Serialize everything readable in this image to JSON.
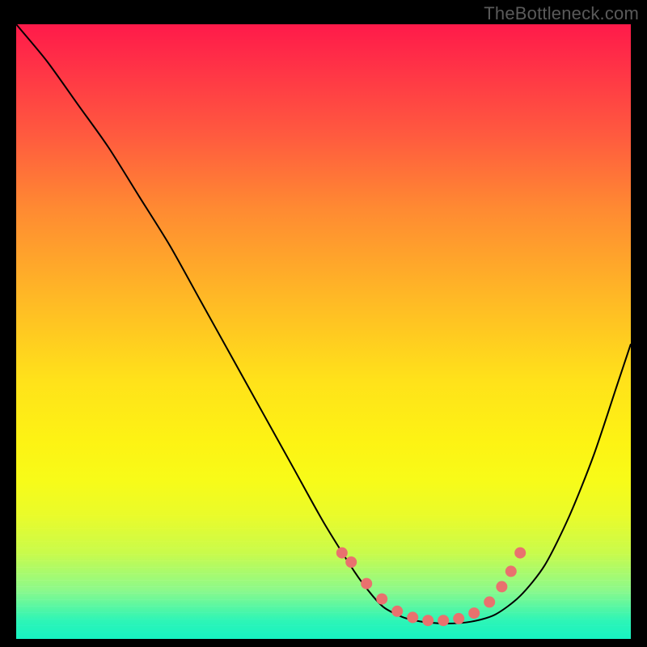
{
  "watermark": "TheBottleneck.com",
  "colors": {
    "frame_bg": "#000000",
    "gradient_top": "#ff1a4a",
    "gradient_bottom": "#16f3c2",
    "curve": "#000000",
    "dot": "#e9716e"
  },
  "chart_data": {
    "type": "line",
    "title": "",
    "xlabel": "",
    "ylabel": "",
    "xlim": [
      0,
      100
    ],
    "ylim": [
      0,
      100
    ],
    "series": [
      {
        "name": "bottleneck-curve",
        "x": [
          0,
          5,
          10,
          15,
          20,
          25,
          30,
          35,
          40,
          45,
          50,
          55,
          58,
          60,
          63,
          66,
          70,
          74,
          78,
          82,
          86,
          90,
          94,
          98,
          100
        ],
        "y": [
          100,
          94,
          87,
          80,
          72,
          64,
          55,
          46,
          37,
          28,
          19,
          11,
          7,
          5,
          3.5,
          2.8,
          2.5,
          2.8,
          4,
          7,
          12,
          20,
          30,
          42,
          48
        ]
      }
    ],
    "markers": {
      "name": "highlight-dots",
      "x": [
        53,
        54.5,
        57,
        59.5,
        62,
        64.5,
        67,
        69.5,
        72,
        74.5,
        77,
        79,
        80.5,
        82
      ],
      "y": [
        14,
        12.5,
        9,
        6.5,
        4.5,
        3.5,
        3.0,
        3.0,
        3.3,
        4.2,
        6.0,
        8.5,
        11,
        14
      ]
    }
  }
}
